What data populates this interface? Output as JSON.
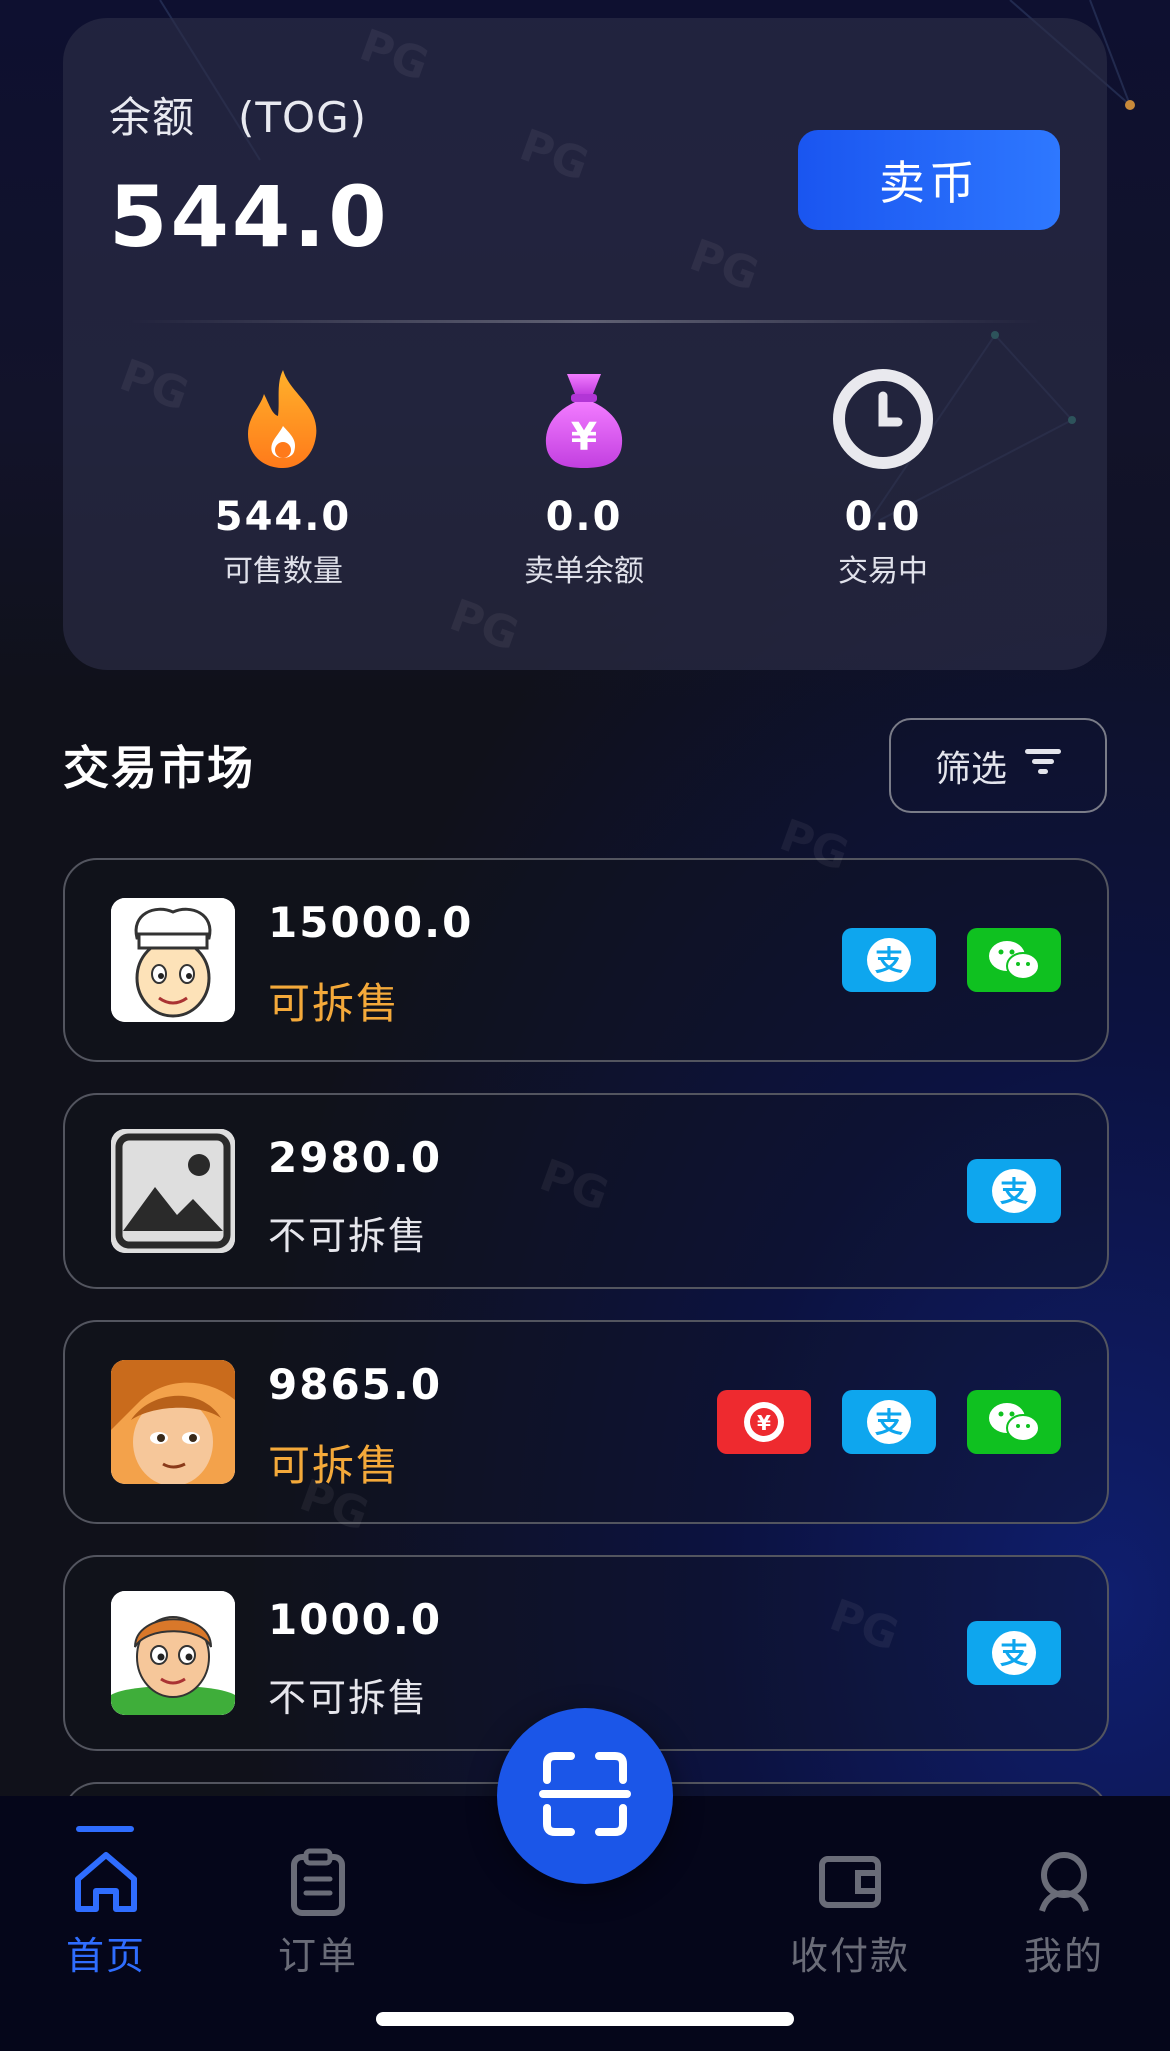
{
  "balance": {
    "label": "余额　(TOG)",
    "value": "544.0",
    "sell_label": "卖币"
  },
  "stats": [
    {
      "icon": "fire-icon",
      "value": "544.0",
      "label": "可售数量"
    },
    {
      "icon": "money-bag-icon",
      "value": "0.0",
      "label": "卖单余额"
    },
    {
      "icon": "clock-icon",
      "value": "0.0",
      "label": "交易中"
    }
  ],
  "market": {
    "title": "交易市场",
    "filter_label": "筛选",
    "rows": [
      {
        "amount": "15000.0",
        "split": "可拆售",
        "splittable": true,
        "payments": [
          "alipay",
          "wechat"
        ]
      },
      {
        "amount": "2980.0",
        "split": "不可拆售",
        "splittable": false,
        "payments": [
          "alipay"
        ]
      },
      {
        "amount": "9865.0",
        "split": "可拆售",
        "splittable": true,
        "payments": [
          "unionpay",
          "alipay",
          "wechat"
        ]
      },
      {
        "amount": "1000.0",
        "split": "不可拆售",
        "splittable": false,
        "payments": [
          "alipay"
        ]
      }
    ]
  },
  "nav": {
    "home": "首页",
    "orders": "订单",
    "payments": "收付款",
    "mine": "我的"
  },
  "colors": {
    "accent": "#2f6dff",
    "splittable": "#f4a93a",
    "alipay": "#0ea6ee",
    "wechat": "#0fc120",
    "unionpay": "#ee2a2f"
  }
}
